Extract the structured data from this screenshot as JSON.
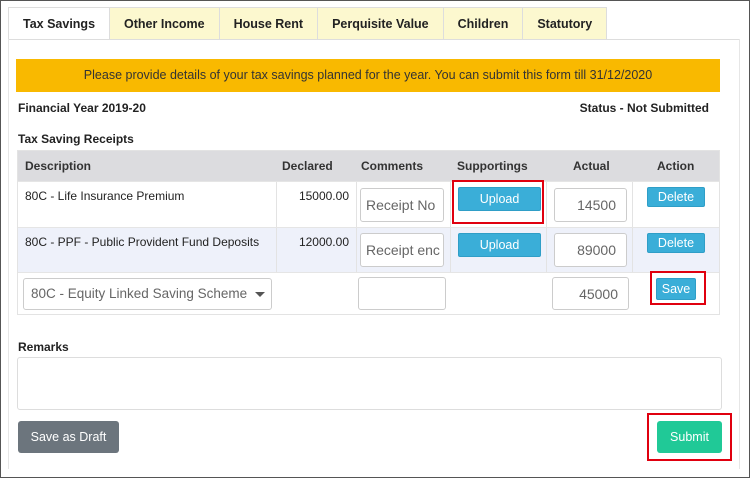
{
  "tabs": [
    {
      "label": "Tax Savings",
      "active": true
    },
    {
      "label": "Other Income",
      "active": false
    },
    {
      "label": "House Rent",
      "active": false
    },
    {
      "label": "Perquisite Value",
      "active": false
    },
    {
      "label": "Children",
      "active": false
    },
    {
      "label": "Statutory",
      "active": false
    }
  ],
  "alert": {
    "text": "Please provide details of your tax savings planned for the year. You can submit this form till 31/12/2020",
    "color": "#f9b900"
  },
  "financial_year": "Financial Year 2019-20",
  "status": "Status - Not Submitted",
  "section_title": "Tax Saving Receipts",
  "table": {
    "headers": {
      "description": "Description",
      "declared": "Declared",
      "comments": "Comments",
      "supportings": "Supportings",
      "actual": "Actual",
      "action": "Action"
    },
    "rows": [
      {
        "description": "80C - Life Insurance Premium",
        "declared": "15000.00",
        "comment_placeholder": "Receipt No",
        "upload_label": "Upload",
        "actual": "14500",
        "action_label": "Delete"
      },
      {
        "description": "80C - PPF - Public Provident Fund Deposits",
        "declared": "12000.00",
        "comment_placeholder": "Receipt enc",
        "upload_label": "Upload",
        "actual": "89000",
        "action_label": "Delete"
      }
    ],
    "new_row": {
      "select_value": "80C - Equity Linked Saving Scheme",
      "actual": "45000",
      "action_label": "Save"
    }
  },
  "remarks": {
    "label": "Remarks",
    "value": ""
  },
  "buttons": {
    "save_draft": "Save as Draft",
    "submit": "Submit"
  },
  "colors": {
    "accent_blue": "#3aaed8",
    "submit_green": "#20c997",
    "draft_gray": "#6c757d",
    "highlight_red": "#e0000f"
  }
}
